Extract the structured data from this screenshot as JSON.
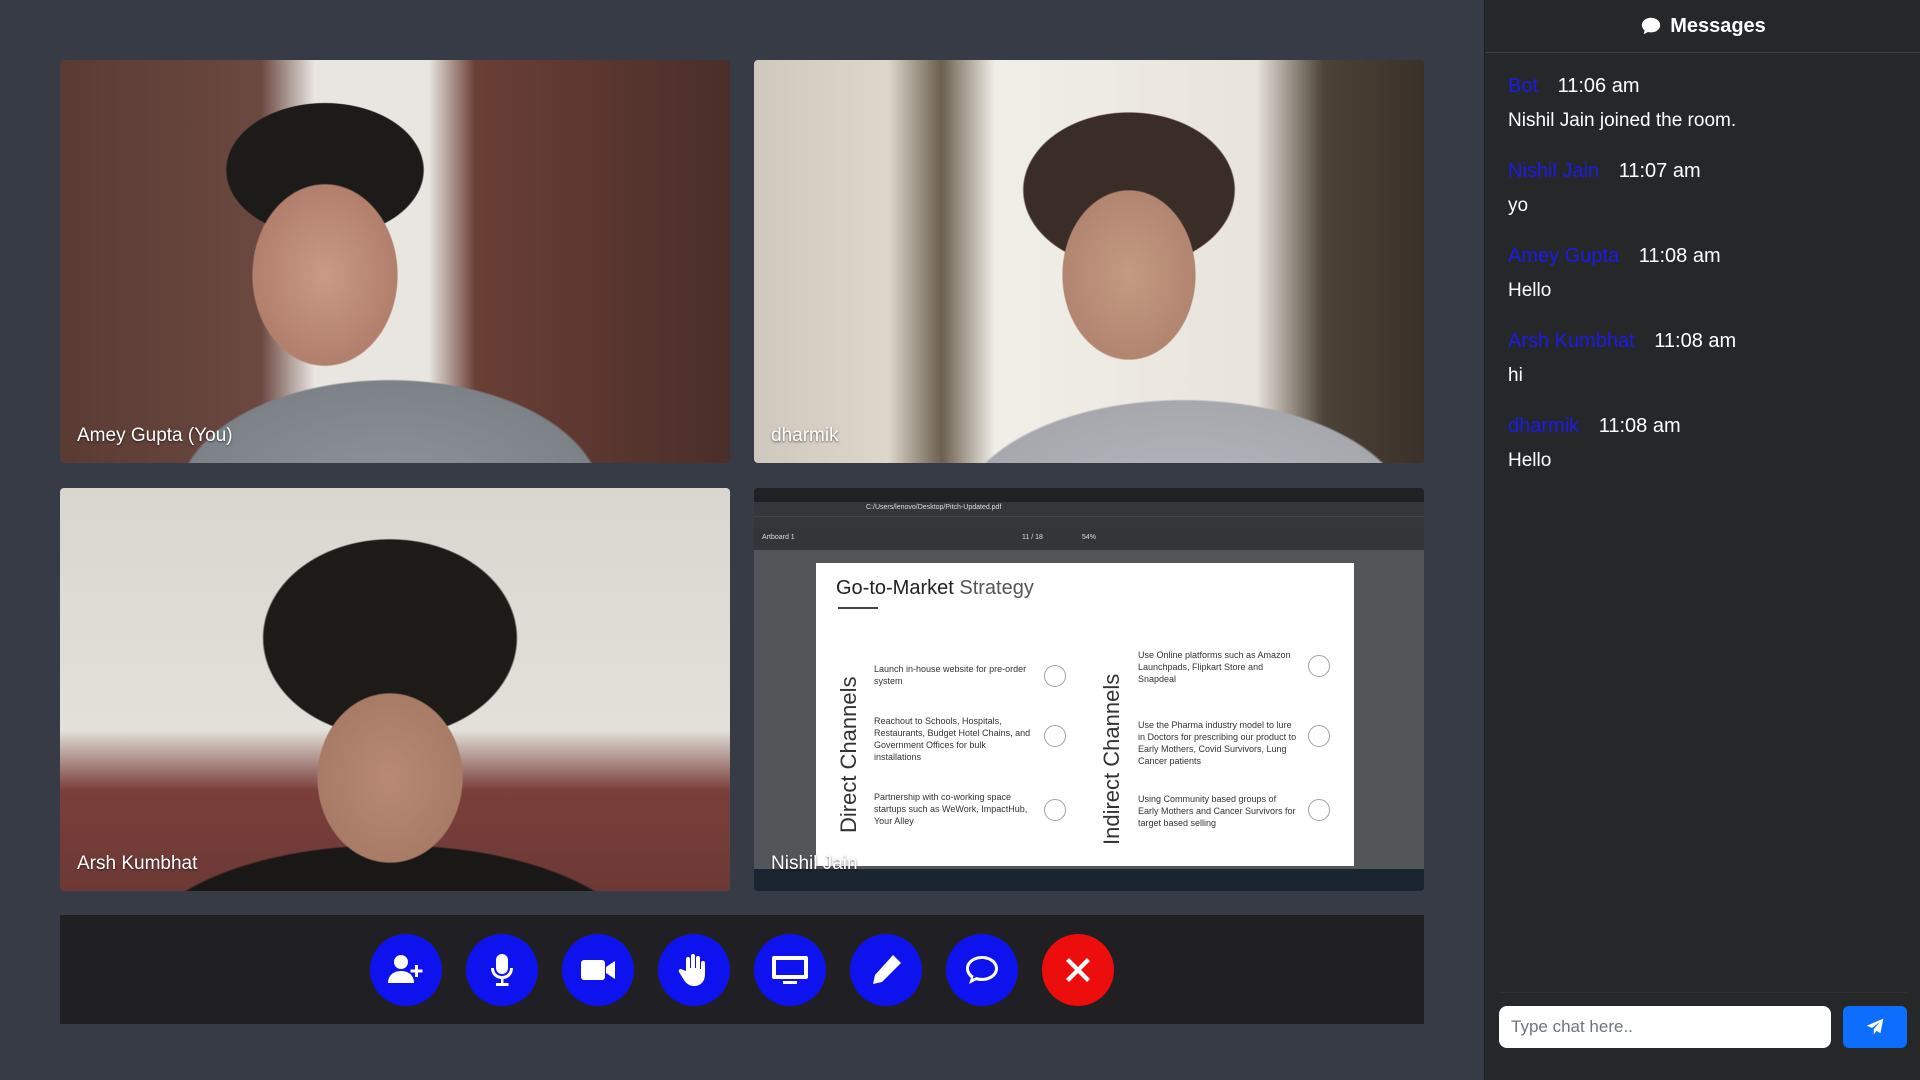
{
  "participants": [
    {
      "name": "Amey Gupta (You)"
    },
    {
      "name": "dharmik"
    },
    {
      "name": "Arsh Kumbhat"
    },
    {
      "name": "Nishil Jain"
    }
  ],
  "screen_share": {
    "slide_title_bold": "Go-to-Market",
    "slide_title_light": "Strategy",
    "direct_label": "Direct Channels",
    "indirect_label": "Indirect Channels",
    "direct_items": [
      "Launch in-house website for pre-order system",
      "Reachout to Schools, Hospitals, Restaurants, Budget Hotel Chains, and Government Offices for bulk installations",
      "Partnership with co-working space startups such as WeWork, ImpactHub, Your Alley"
    ],
    "indirect_items": [
      "Use Online platforms such as Amazon Launchpads, Flipkart Store and Snapdeal",
      "Use the Pharma industry model to lure in Doctors for prescribing our product to Early Mothers, Covid Survivors, Lung Cancer patients",
      "Using Community based groups of Early Mothers and Cancer Survivors for target based selling"
    ],
    "pdf_path": "C:/Users/lenovo/Desktop/Pitch-Updated.pdf",
    "artboard_label": "Artboard 1",
    "page_indicator": "11 / 18",
    "zoom": "54%"
  },
  "controls": [
    {
      "icon": "add-user-icon"
    },
    {
      "icon": "microphone-icon"
    },
    {
      "icon": "video-camera-icon"
    },
    {
      "icon": "raise-hand-icon"
    },
    {
      "icon": "screen-share-icon"
    },
    {
      "icon": "pencil-icon"
    },
    {
      "icon": "chat-bubble-icon"
    },
    {
      "icon": "end-call-icon"
    }
  ],
  "chat": {
    "title": "Messages",
    "messages": [
      {
        "sender": "Bot",
        "time": "11:06 am",
        "text": "Nishil Jain joined the room."
      },
      {
        "sender": "Nishil Jain",
        "time": "11:07 am",
        "text": "yo"
      },
      {
        "sender": "Amey Gupta",
        "time": "11:08 am",
        "text": "Hello"
      },
      {
        "sender": "Arsh Kumbhat",
        "time": "11:08 am",
        "text": "hi"
      },
      {
        "sender": "dharmik",
        "time": "11:08 am",
        "text": "Hello"
      }
    ],
    "input_placeholder": "Type chat here.."
  },
  "colors": {
    "background": "#363b46",
    "control_blue": "#0d12ee",
    "control_red": "#ee0d0d",
    "sender_blue": "#1b1bea",
    "send_button": "#0d6efd"
  }
}
